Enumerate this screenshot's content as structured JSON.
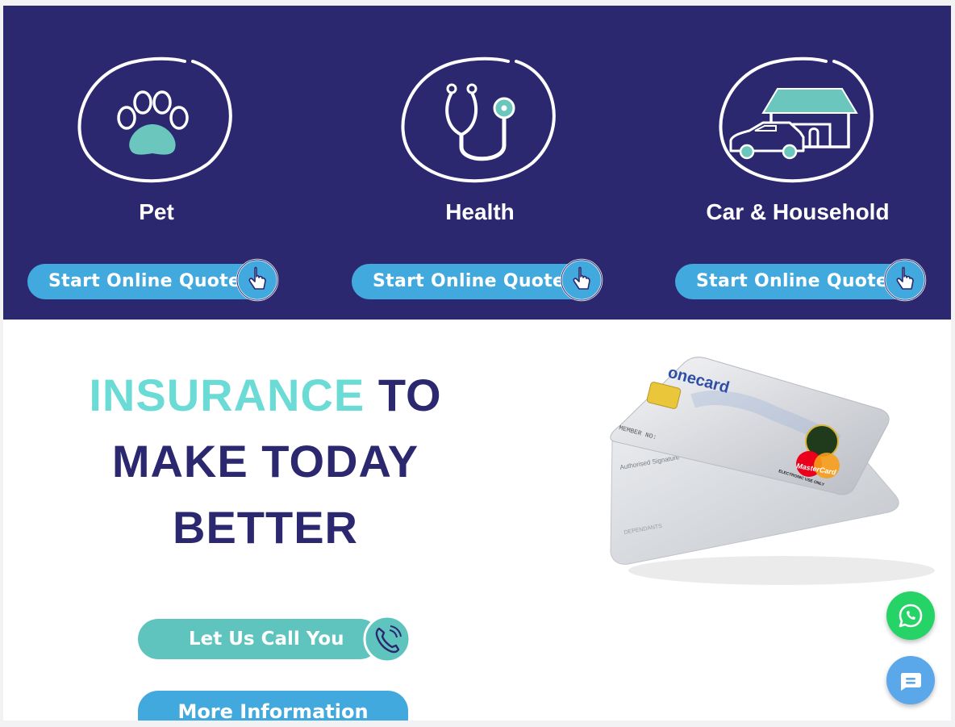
{
  "products": [
    {
      "title": "Pet",
      "button_label": "Start Online Quote",
      "icon": "paw-icon"
    },
    {
      "title": "Health",
      "button_label": "Start Online Quote",
      "icon": "stethoscope-icon"
    },
    {
      "title": "Car & Household",
      "button_label": "Start Online Quote",
      "icon": "car-house-icon"
    }
  ],
  "hero": {
    "headline_accent": "INSURANCE",
    "headline_rest_line1": " TO",
    "headline_line2": "MAKE TODAY",
    "headline_line3": "BETTER",
    "card_brand": "onecard",
    "card_network": "MasterCard",
    "card_member_label": "MEMBER NO:",
    "card_usage_label": "ELECTRONIC USE ONLY",
    "card_signature_label": "Authorised Signature",
    "card_dependants_label": "DEPENDANTS"
  },
  "actions": {
    "call_label": "Let Us Call You",
    "info_label": "More Information"
  },
  "floating": {
    "whatsapp_icon": "whatsapp-icon",
    "chat_icon": "chat-icon"
  },
  "colors": {
    "band": "#2b2870",
    "accent_teal": "#6bdbd6",
    "button_blue": "#42a9df",
    "button_teal": "#5ec4bd",
    "whatsapp_green": "#25d366"
  }
}
